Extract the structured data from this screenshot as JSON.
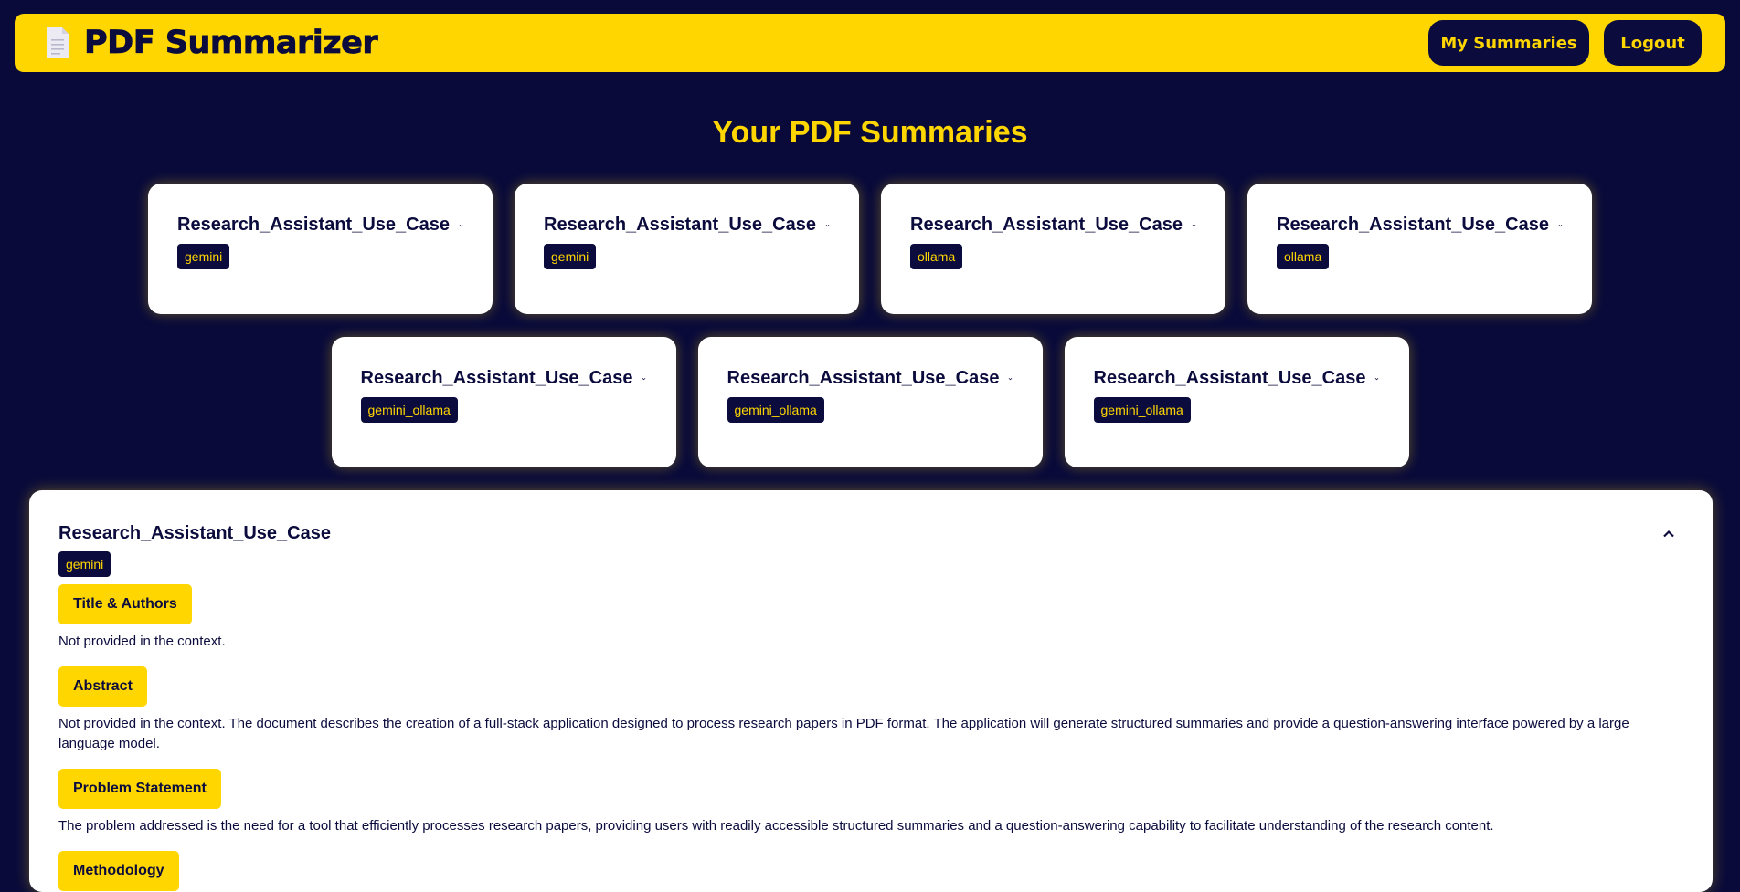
{
  "navbar": {
    "brand_icon": "document-icon",
    "title": "PDF Summarizer",
    "my_summaries_label": "My Summaries",
    "logout_label": "Logout"
  },
  "page": {
    "title": "Your PDF Summaries"
  },
  "cards": [
    {
      "title": "Research_Assistant_Use_Case",
      "model": "gemini"
    },
    {
      "title": "Research_Assistant_Use_Case",
      "model": "gemini"
    },
    {
      "title": "Research_Assistant_Use_Case",
      "model": "ollama"
    },
    {
      "title": "Research_Assistant_Use_Case",
      "model": "ollama"
    },
    {
      "title": "Research_Assistant_Use_Case",
      "model": "gemini_ollama"
    },
    {
      "title": "Research_Assistant_Use_Case",
      "model": "gemini_ollama"
    },
    {
      "title": "Research_Assistant_Use_Case",
      "model": "gemini_ollama"
    }
  ],
  "detail": {
    "title": "Research_Assistant_Use_Case",
    "model": "gemini",
    "sections": [
      {
        "label": "Title & Authors",
        "text": "Not provided in the context."
      },
      {
        "label": "Abstract",
        "text": "Not provided in the context. The document describes the creation of a full-stack application designed to process research papers in PDF format. The application will generate structured summaries and provide a question-answering interface powered by a large language model."
      },
      {
        "label": "Problem Statement",
        "text": "The problem addressed is the need for a tool that efficiently processes research papers, providing users with readily accessible structured summaries and a question-answering capability to facilitate understanding of the research content."
      },
      {
        "label": "Methodology",
        "text": ""
      }
    ]
  },
  "colors": {
    "background": "#090a3a",
    "accent": "#ffd600",
    "card": "#ffffff"
  }
}
